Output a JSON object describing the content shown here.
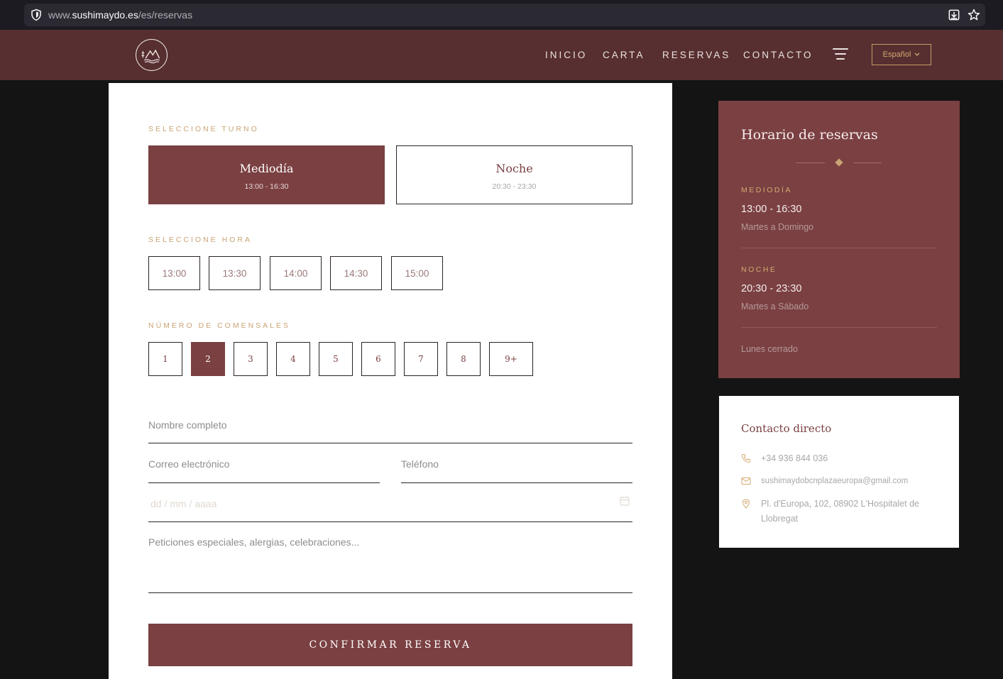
{
  "browser": {
    "url_prefix": "www.",
    "url_domain": "sushimaydo.es",
    "url_path": "/es/reservas"
  },
  "header": {
    "nav": [
      "INICIO",
      "CARTA",
      "RESERVAS",
      "CONTACTO"
    ],
    "language": "Español"
  },
  "form": {
    "turno_label": "SELECCIONE TURNO",
    "turnos": [
      {
        "name": "Mediodía",
        "time": "13:00 - 16:30",
        "selected": true
      },
      {
        "name": "Noche",
        "time": "20:30 - 23:30",
        "selected": false
      }
    ],
    "hora_label": "SELECCIONE HORA",
    "horas": [
      "13:00",
      "13:30",
      "14:00",
      "14:30",
      "15:00"
    ],
    "comensales_label": "NÚMERO DE COMENSALES",
    "comensales": [
      "1",
      "2",
      "3",
      "4",
      "5",
      "6",
      "7",
      "8",
      "9+"
    ],
    "comensales_selected": "2",
    "name_placeholder": "Nombre completo",
    "email_placeholder": "Correo electrónico",
    "phone_placeholder": "Teléfono",
    "date_placeholder": "dd / mm / aaaa",
    "notes_placeholder": "Peticiones especiales, alergias, celebraciones...",
    "submit": "CONFIRMAR RESERVA"
  },
  "schedule": {
    "title": "Horario de reservas",
    "mediodia_label": "MEDIODÍA",
    "mediodia_time": "13:00 - 16:30",
    "mediodia_days": "Martes a Domingo",
    "noche_label": "NOCHE",
    "noche_time": "20:30 - 23:30",
    "noche_days": "Martes a Sábado",
    "closed": "Lunes cerrado"
  },
  "contact": {
    "title": "Contacto directo",
    "phone": "+34 936 844 036",
    "email": "sushimaydobcnplazaeuropa@gmail.com",
    "address": "Pl. d'Europa, 102, 08902 L'Hospitalet de Llobregat"
  },
  "colors": {
    "brand": "#7b4042",
    "header": "#572f31",
    "accent": "#c9a373"
  },
  "icons": [
    "shield-icon",
    "download-icon",
    "star-icon",
    "logo-icon",
    "menu-icon",
    "chevron-down-icon",
    "calendar-icon",
    "diamond-icon",
    "phone-icon",
    "mail-icon",
    "location-icon"
  ]
}
